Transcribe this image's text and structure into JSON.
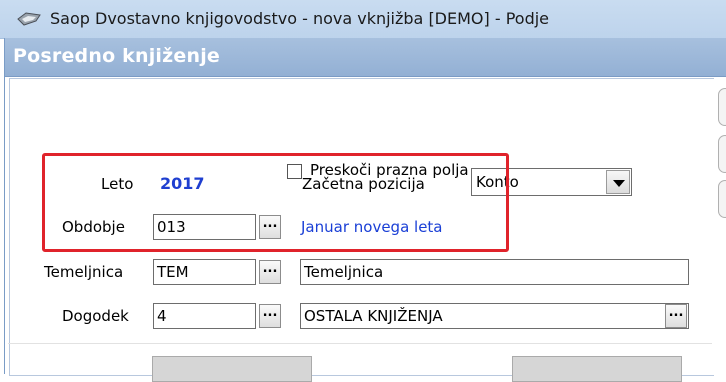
{
  "window": {
    "title": "Saop Dvostavno knjigovodstvo - nova vknjižba [DEMO] - Podje"
  },
  "header": {
    "title": "Posredno knjiženje"
  },
  "form": {
    "skip_empty_label": "Preskoči prazna polja",
    "leto_label": "Leto",
    "leto_value": "2017",
    "start_position_label": "Začetna pozicija",
    "start_position_value": "Konto",
    "obdobje_label": "Obdobje",
    "obdobje_value": "013",
    "obdobje_description": "Januar novega leta",
    "temeljnica_label": "Temeljnica",
    "temeljnica_code": "TEM",
    "temeljnica_name": "Temeljnica",
    "dogodek_label": "Dogodek",
    "dogodek_code": "4",
    "dogodek_name": "OSTALA KNJIŽENJA",
    "ellipsis": "..."
  },
  "colors": {
    "highlight_border": "#e0232b",
    "year_blue": "#1f3fd0",
    "header_bg": "#a7c0de"
  },
  "icons": {
    "app": "saop-app-icon",
    "dropdown": "chevron-down-icon"
  }
}
